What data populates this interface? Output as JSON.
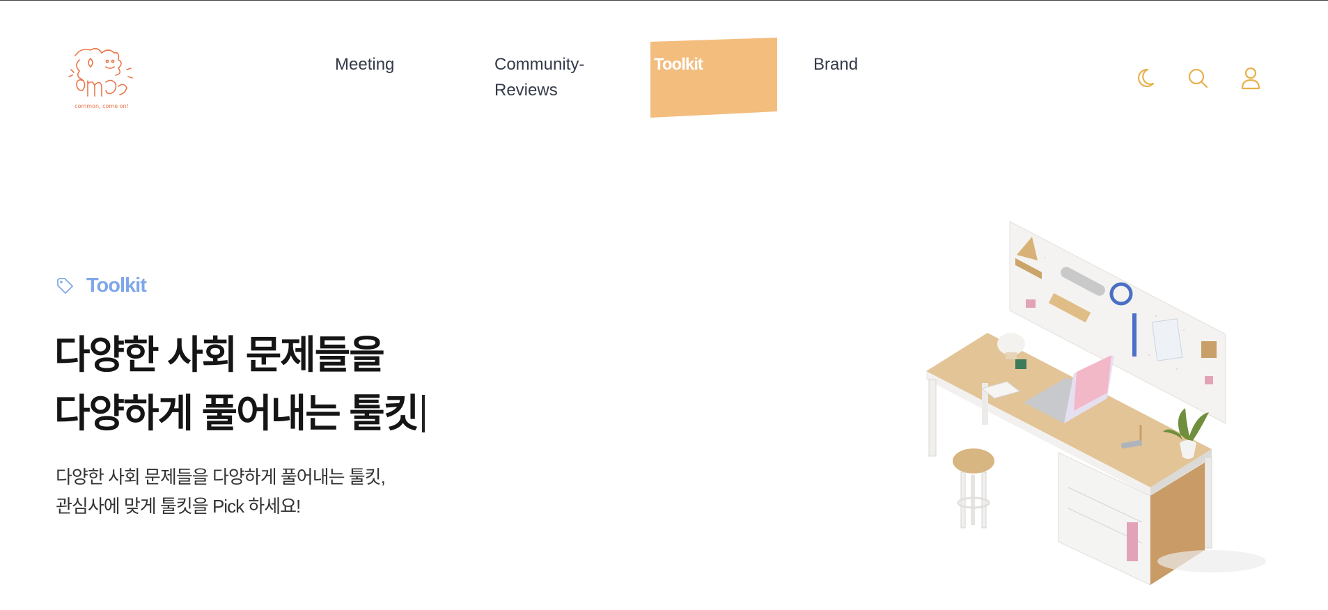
{
  "header": {
    "logo_text": "common, come on!",
    "nav": [
      {
        "label": "Meeting"
      },
      {
        "label": "Community-",
        "label2": "Reviews"
      },
      {
        "label": "Toolkit",
        "active": true
      },
      {
        "label": "Brand"
      }
    ],
    "icons": [
      "moon-icon",
      "search-icon",
      "user-icon"
    ],
    "accent_color": "#f3bd7e",
    "icon_color": "#e7b04a"
  },
  "hero": {
    "tag_label": "Toolkit",
    "tag_icon": "tag-icon",
    "tag_color": "#7fa7ea",
    "headline_line1": "다양한 사회 문제들을",
    "headline_line2": "다양하게 풀어내는 툴킷",
    "desc_line1": "다양한 사회 문제들을 다양하게 풀어내는 툴킷,",
    "desc_line2": "관심사에 맞게 툴킷을 Pick 하세요!"
  }
}
